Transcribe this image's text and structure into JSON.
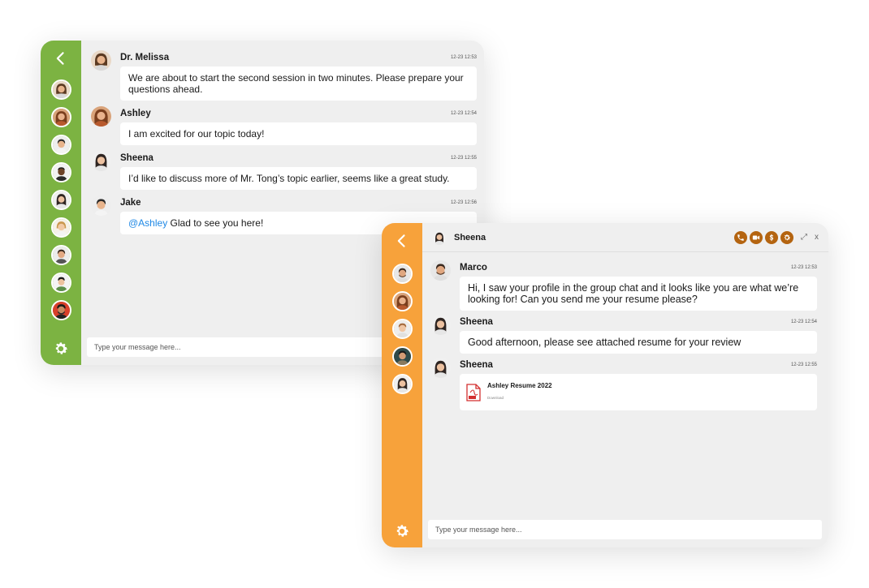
{
  "colors": {
    "green_sidebar": "#7cb342",
    "orange_sidebar": "#f7a23b",
    "action_brown": "#b46410",
    "mention_blue": "#1e88e5"
  },
  "chat1": {
    "sidebar": {
      "back_icon": "chevron-left-icon",
      "settings_icon": "gear-icon",
      "avatar_count": 9
    },
    "messages": [
      {
        "sender": "Dr. Melissa",
        "time": "12-23 12:53",
        "text": "We are about to start the second session in two minutes. Please prepare your questions ahead."
      },
      {
        "sender": "Ashley",
        "time": "12-23 12:54",
        "text": "I am excited for our topic today!"
      },
      {
        "sender": "Sheena",
        "time": "12-23 12:55",
        "text": "I’d like to discuss more of Mr. Tong’s topic earlier, seems like a great study."
      },
      {
        "sender": "Jake",
        "time": "12-23 12:56",
        "mention": "@Ashley",
        "text": " Glad to see you here!"
      }
    ],
    "input": {
      "placeholder": "Type your message here..."
    }
  },
  "chat2": {
    "header": {
      "name": "Sheena",
      "actions": [
        "phone-icon",
        "video-icon",
        "dollar-icon",
        "gear-icon"
      ],
      "expand_label": "⤢",
      "close_label": "x"
    },
    "sidebar": {
      "back_icon": "chevron-left-icon",
      "settings_icon": "gear-icon",
      "avatar_count": 5
    },
    "messages": [
      {
        "sender": "Marco",
        "time": "12-23 12:53",
        "text": "Hi, I saw your profile in the group chat and it looks like you are what we’re looking for! Can you send me your resume please?"
      },
      {
        "sender": "Sheena",
        "time": "12-23 12:54",
        "text": "Good afternoon, please see attached resume for your review"
      },
      {
        "sender": "Sheena",
        "time": "12-23 12:55",
        "file": {
          "icon": "pdf-file-icon",
          "name": "Ashley Resume 2022",
          "action": "Download"
        }
      }
    ],
    "input": {
      "placeholder": "Type your message here..."
    }
  }
}
